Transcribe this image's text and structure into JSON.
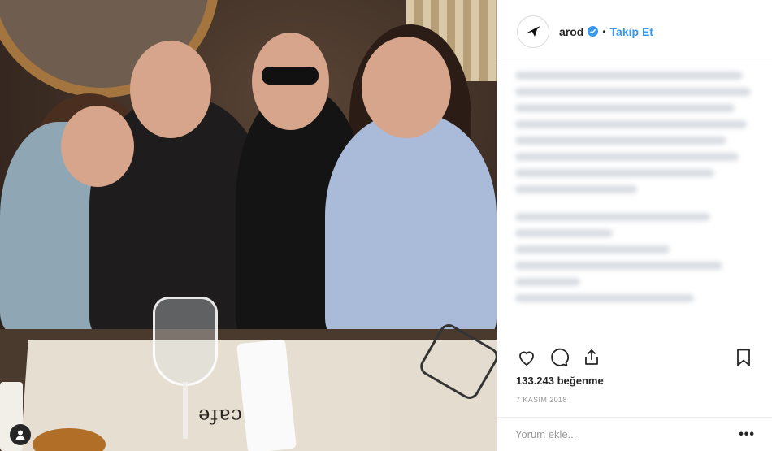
{
  "post": {
    "photo_text": "cafe",
    "username": "arod",
    "follow_label": "Takip Et",
    "dot": "•",
    "likes_text": "133.243 beğenme",
    "date_text": "7 KASIM 2018",
    "comment_placeholder": "Yorum ekle...",
    "more_label": "•••"
  },
  "icons": {
    "like": "heart-icon",
    "comment": "speech-bubble-icon",
    "share": "share-icon",
    "save": "bookmark-icon",
    "verified": "verified-badge-icon",
    "user": "user-icon"
  },
  "colors": {
    "link_blue": "#3897f0",
    "text": "#262626",
    "muted": "#999999",
    "border": "#efefef"
  }
}
